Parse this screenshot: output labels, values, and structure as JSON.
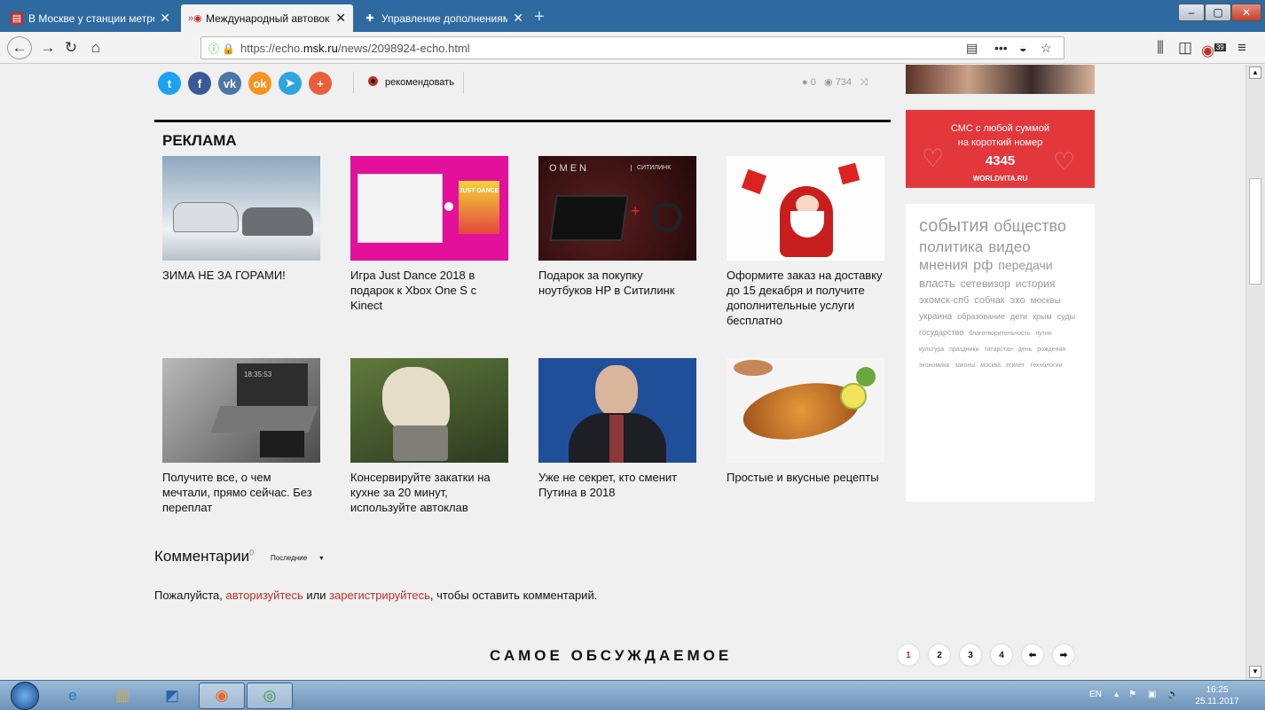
{
  "browser": {
    "tabs": [
      {
        "icon": "news-icon",
        "title": "В Москве у станции метро «Х",
        "close": "✕"
      },
      {
        "icon": "echo-icon",
        "title": "Международный автовокзал в",
        "close": "✕"
      },
      {
        "icon": "puzzle-icon",
        "title": "Управление дополнениями",
        "close": "✕"
      }
    ],
    "new_tab": "+",
    "window_buttons": [
      "–",
      "▢",
      "✕"
    ],
    "url_prefix": "https://echo.",
    "url_host": "msk.ru",
    "url_path": "/news/2098924-echo.html",
    "url_more": "•••",
    "badge_count": "39"
  },
  "article": {
    "share_buttons": [
      {
        "icon": "twitter-icon",
        "glyph": "t",
        "color": "#1da1f2"
      },
      {
        "icon": "facebook-icon",
        "glyph": "f",
        "color": "#3b5998"
      },
      {
        "icon": "vk-icon",
        "glyph": "vk",
        "color": "#4a76a8"
      },
      {
        "icon": "odnoklassniki-icon",
        "glyph": "ok",
        "color": "#f7931e"
      },
      {
        "icon": "telegram-icon",
        "glyph": "➤",
        "color": "#2ca5e0"
      },
      {
        "icon": "plus-icon",
        "glyph": "+",
        "color": "#e95e3a"
      }
    ],
    "recommend_label": "рекомендовать",
    "comment_count": "0",
    "view_count": "734"
  },
  "ads": {
    "heading": "РЕКЛАМА",
    "cards": [
      {
        "caption": "ЗИМА НЕ ЗА ГОРАМИ!"
      },
      {
        "caption": "Игра Just Dance 2018 в подарок к Xbox One S с Kinect"
      },
      {
        "caption": "Подарок за покупку ноутбуков HP в Ситилинк"
      },
      {
        "caption": "Оформите заказ на доставку до 15 декабря и получите дополнительные услуги бесплатно"
      },
      {
        "caption": "Получите все, о чем мечтали, прямо сейчас. Без переплат"
      },
      {
        "caption": "Консервируйте закатки на кухне за 20 минут, используйте автоклав"
      },
      {
        "caption": "Уже не секрет, кто сменит Путина в 2018"
      },
      {
        "caption": "Простые и вкусные рецепты"
      }
    ],
    "img_text": {
      "just_dance": "JUST DANCE",
      "omen": "OMEN",
      "citilink": "СИТИЛИНК",
      "clock": "18:35:53"
    }
  },
  "comments": {
    "title": "Комментарии",
    "count": "0",
    "sort": "Последние",
    "login_pre": "Пожалуйста, ",
    "login_link": "авторизуйтесь",
    "login_mid": " или ",
    "register_link": "зарегистрируйтесь",
    "login_post": ", чтобы оставить комментарий."
  },
  "most_discussed": {
    "title": "САМОЕ ОБСУЖДАЕМОЕ",
    "pages": [
      "1",
      "2",
      "3",
      "4"
    ]
  },
  "sidebar": {
    "banner": {
      "line1": "СМС с любой суммой",
      "line2": "на короткий номер",
      "number": "4345",
      "site": "WORLDVITA.RU"
    },
    "tags": [
      {
        "label": "события",
        "size": 20
      },
      {
        "label": "общество",
        "size": 18
      },
      {
        "label": "политика",
        "size": 17
      },
      {
        "label": "видео",
        "size": 17
      },
      {
        "label": "мнения",
        "size": 16
      },
      {
        "label": "рф",
        "size": 16
      },
      {
        "label": "передачи",
        "size": 14
      },
      {
        "label": "власть",
        "size": 13
      },
      {
        "label": "сетевизор",
        "size": 12
      },
      {
        "label": "история",
        "size": 12
      },
      {
        "label": "эхомск-спб",
        "size": 11
      },
      {
        "label": "собчак",
        "size": 11
      },
      {
        "label": "эхо",
        "size": 11
      },
      {
        "label": "москвы",
        "size": 10
      },
      {
        "label": "украина",
        "size": 10
      },
      {
        "label": "образование",
        "size": 9
      },
      {
        "label": "дети",
        "size": 9
      },
      {
        "label": "крым",
        "size": 9
      },
      {
        "label": "суды",
        "size": 9
      },
      {
        "label": "государство",
        "size": 9
      },
      {
        "label": "благотворительность",
        "size": 7
      },
      {
        "label": "путин",
        "size": 7
      },
      {
        "label": "культура",
        "size": 7
      },
      {
        "label": "праздники",
        "size": 7
      },
      {
        "label": "татарстан",
        "size": 7
      },
      {
        "label": "день",
        "size": 7
      },
      {
        "label": "рождения",
        "size": 7
      },
      {
        "label": "экономика",
        "size": 7
      },
      {
        "label": "законы",
        "size": 7
      },
      {
        "label": "москва",
        "size": 7
      },
      {
        "label": "египет",
        "size": 7
      },
      {
        "label": "технологии",
        "size": 7
      }
    ]
  },
  "taskbar": {
    "language": "EN",
    "time": "16:25",
    "date": "25.11.2017"
  },
  "colors": {
    "accent": "#c0302a",
    "banner": "#e2383c",
    "tabbar": "#2e6aa0"
  }
}
